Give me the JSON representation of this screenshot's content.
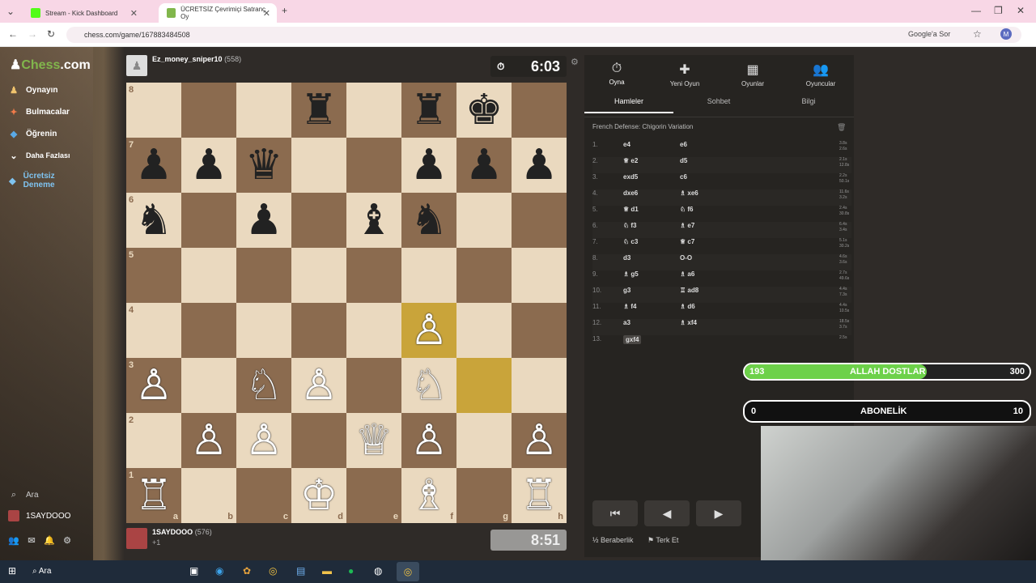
{
  "browser": {
    "tabs": [
      {
        "label": "Stream - Kick Dashboard",
        "color": "#53fc18"
      },
      {
        "label": "ÜCRETSİZ Çevrimiçi Satranç Oy",
        "color": "#81b64c"
      }
    ],
    "url": "chess.com/game/167883484508",
    "ask_google": "Google'a Sor",
    "profile_initial": "M"
  },
  "sidebar": {
    "logo_pre": "Chess",
    "logo_post": ".com",
    "items": [
      {
        "label": "Oynayın"
      },
      {
        "label": "Bulmacalar"
      },
      {
        "label": "Öğrenin"
      },
      {
        "label": "Daha Fazlası"
      },
      {
        "label": "Ücretsiz Deneme"
      }
    ],
    "search": "Ara",
    "username": "1SAYDOOO"
  },
  "top_player": {
    "name": "Ez_money_sniper10",
    "rating": "(558)",
    "clock": "6:03"
  },
  "bottom_player": {
    "name": "1SAYDOOO",
    "rating": "(576)",
    "clock": "8:51",
    "extra": "+1"
  },
  "board": {
    "ranks": [
      "8",
      "7",
      "6",
      "5",
      "4",
      "3",
      "2",
      "1"
    ],
    "files": [
      "a",
      "b",
      "c",
      "d",
      "e",
      "f",
      "g",
      "h"
    ],
    "rows": [
      [
        "",
        "",
        "",
        "♜",
        "",
        "♜",
        "♚",
        ""
      ],
      [
        "♟",
        "♟",
        "♛",
        "",
        "",
        "♟",
        "♟",
        "♟"
      ],
      [
        "♞",
        "",
        "♟",
        "",
        "♝",
        "♞",
        "",
        ""
      ],
      [
        "",
        "",
        "",
        "",
        "",
        "",
        "",
        ""
      ],
      [
        "",
        "",
        "",
        "",
        "",
        "♙",
        "",
        ""
      ],
      [
        "♙",
        "",
        "♘",
        "♙",
        "",
        "♘",
        "",
        ""
      ],
      [
        "",
        "♙",
        "♙",
        "",
        "♕",
        "♙",
        "",
        "♙"
      ],
      [
        "♖",
        "",
        "",
        "♔",
        "",
        "♗",
        "",
        "♖"
      ]
    ],
    "white_pieces": [
      "♙",
      "♘",
      "♗",
      "♖",
      "♕",
      "♔"
    ]
  },
  "panel": {
    "tabs": [
      {
        "label": "Oyna",
        "icon": "⏱"
      },
      {
        "label": "Yeni Oyun",
        "icon": "✚"
      },
      {
        "label": "Oyunlar",
        "icon": "▦"
      },
      {
        "label": "Oyuncular",
        "icon": "👥"
      }
    ],
    "subtabs": [
      "Hamleler",
      "Sohbet",
      "Bilgi"
    ],
    "opening": "French Defense: Chigorin Variation",
    "moves": [
      {
        "n": "1.",
        "w": "e4",
        "b": "e6",
        "t": "3.8s 2.6s"
      },
      {
        "n": "2.",
        "w": "♕ e2",
        "b": "d5",
        "t": "2.1s 12.8s"
      },
      {
        "n": "3.",
        "w": "exd5",
        "b": "c6",
        "t": "2.2s 50.1s"
      },
      {
        "n": "4.",
        "w": "dxe6",
        "b": "♗ xe6",
        "t": "11.6s 3.2s"
      },
      {
        "n": "5.",
        "w": "♕ d1",
        "b": "♘ f6",
        "t": "2.4s 30.8s"
      },
      {
        "n": "6.",
        "w": "♘ f3",
        "b": "♗ e7",
        "t": "6.4s 3.4s"
      },
      {
        "n": "7.",
        "w": "♘ c3",
        "b": "♕ c7",
        "t": "5.1s 30.2s"
      },
      {
        "n": "8.",
        "w": "d3",
        "b": "O-O",
        "t": "4.6s 3.6s"
      },
      {
        "n": "9.",
        "w": "♗ g5",
        "b": "♗ a6",
        "t": "2.7s 49.6s"
      },
      {
        "n": "10.",
        "w": "g3",
        "b": "♖ ad8",
        "t": "4.4s 7.3s"
      },
      {
        "n": "11.",
        "w": "♗ f4",
        "b": "♗ d6",
        "t": "4.4s 10.5s"
      },
      {
        "n": "12.",
        "w": "a3",
        "b": "♗ xf4",
        "t": "18.5s 3.7s"
      },
      {
        "n": "13.",
        "w": "gxf4",
        "b": "",
        "t": "2.5s"
      }
    ],
    "controls": [
      "⏮",
      "◀",
      "▶"
    ],
    "draw": "Beraberlik",
    "resign": "Terk Et"
  },
  "overlays": {
    "goal1": {
      "left": "193",
      "label": "ALLAH DOSTLAR",
      "right": "300",
      "progress": 0.64
    },
    "goal2": {
      "left": "0",
      "label": "ABONELİK",
      "right": "10",
      "progress": 0
    }
  },
  "taskbar": {
    "search": "Ara"
  }
}
